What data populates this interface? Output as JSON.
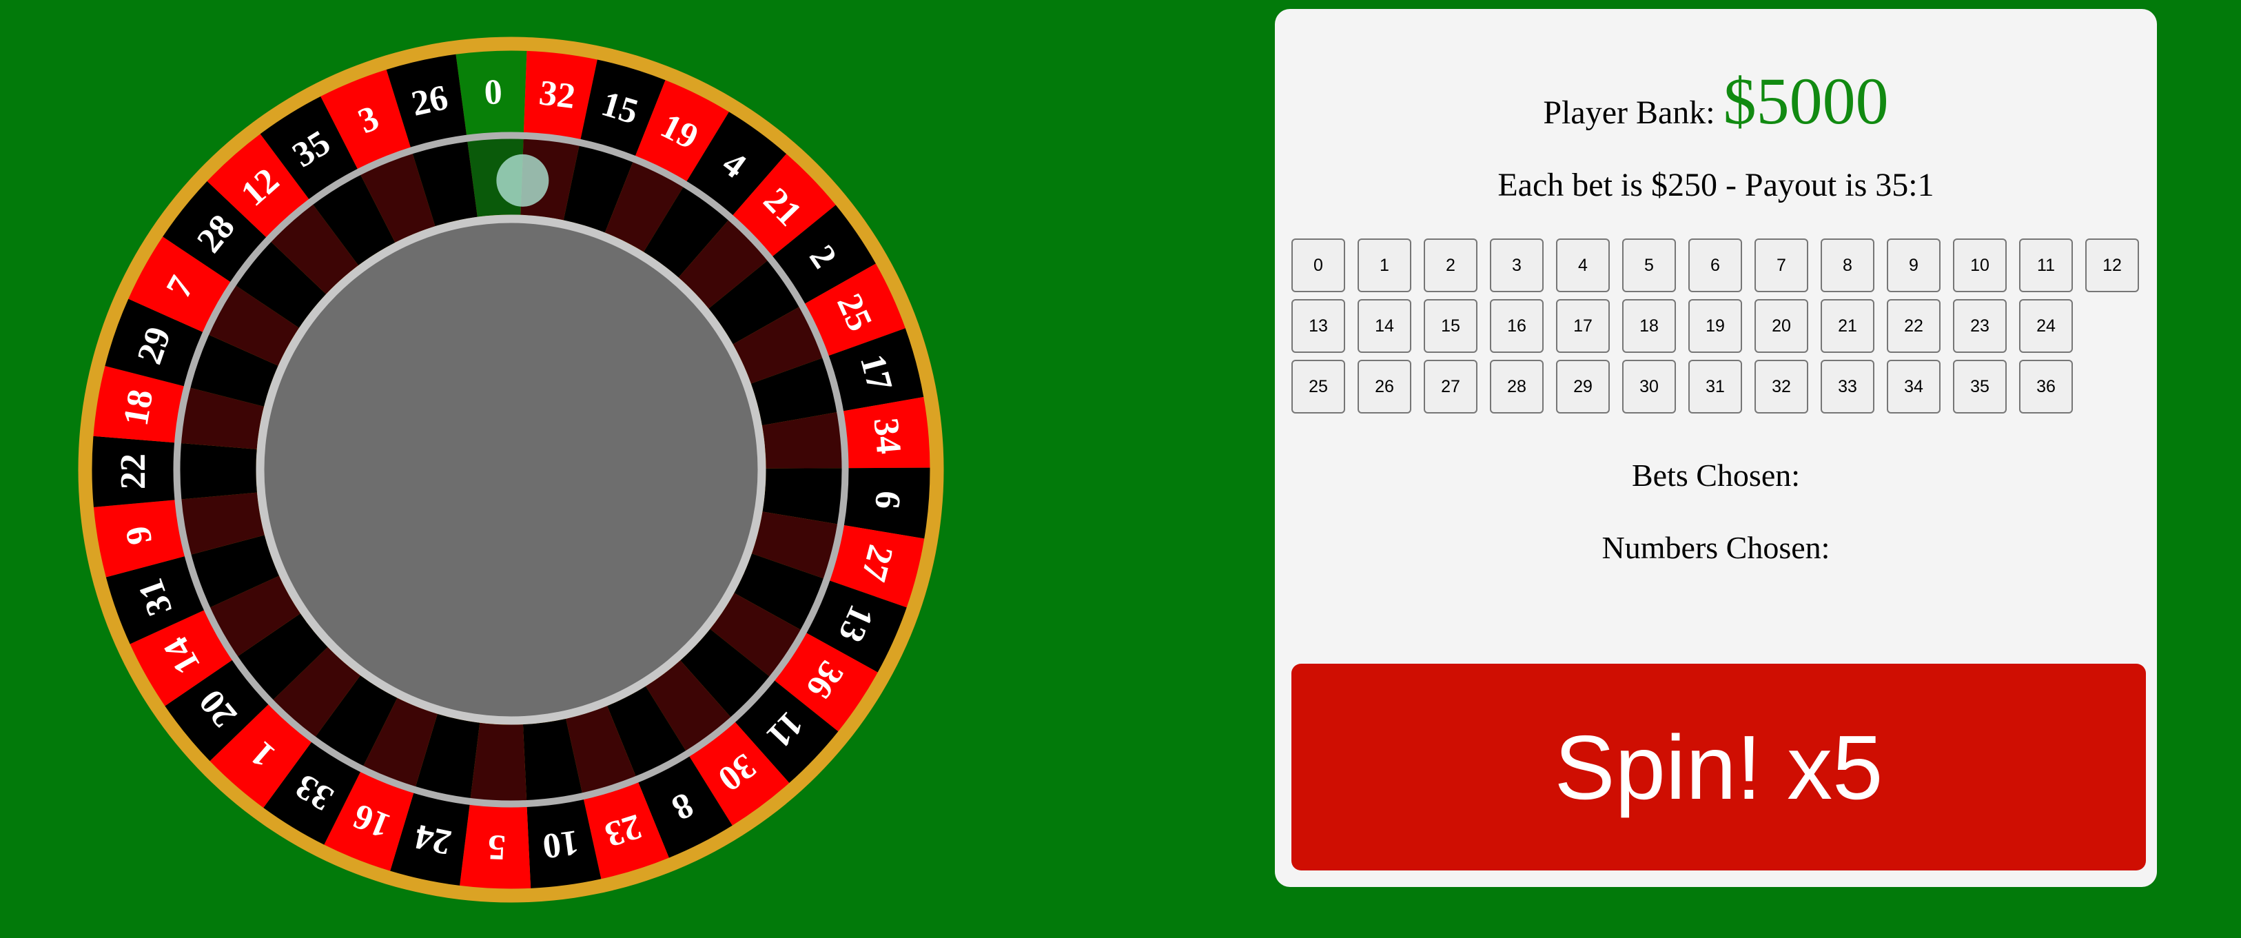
{
  "wheel": {
    "pockets": [
      "0",
      "32",
      "15",
      "19",
      "4",
      "21",
      "2",
      "25",
      "17",
      "34",
      "6",
      "27",
      "13",
      "36",
      "11",
      "30",
      "8",
      "23",
      "10",
      "5",
      "24",
      "16",
      "33",
      "1",
      "20",
      "14",
      "31",
      "9",
      "22",
      "18",
      "29",
      "7",
      "28",
      "12",
      "35",
      "3",
      "26"
    ],
    "colors": {
      "green": "#088008",
      "red": "#ff0000",
      "black": "#000000",
      "rim": "#dba324",
      "hub": "#6e6e6e",
      "ball": "#a6d8c8"
    }
  },
  "panel": {
    "bank_label": "Player Bank:",
    "bank_value": "$5000",
    "rules_text": "Each bet is $250 - Payout is 35:1",
    "bet_rows": [
      [
        "0",
        "1",
        "2",
        "3",
        "4",
        "5",
        "6",
        "7",
        "8",
        "9",
        "10",
        "11",
        "12"
      ],
      [
        "13",
        "14",
        "15",
        "16",
        "17",
        "18",
        "19",
        "20",
        "21",
        "22",
        "23",
        "24"
      ],
      [
        "25",
        "26",
        "27",
        "28",
        "29",
        "30",
        "31",
        "32",
        "33",
        "34",
        "35",
        "36"
      ]
    ],
    "bets_chosen_label": "Bets Chosen:",
    "numbers_chosen_label": "Numbers Chosen:",
    "spin_label": "Spin! x5"
  }
}
